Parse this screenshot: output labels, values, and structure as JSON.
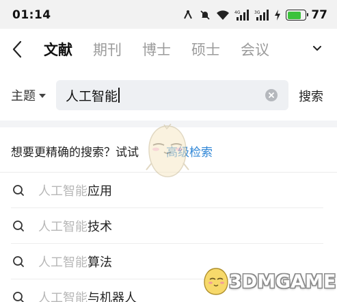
{
  "status_bar": {
    "time": "01:14",
    "battery_level": "77",
    "battery_percent": 0.77,
    "icons": [
      "nfc-icon",
      "mute-icon",
      "wifi-icon",
      "signal-4g-icon",
      "signal-3g-icon",
      "charging-icon",
      "battery-icon"
    ],
    "battery_color": "#3bc23b"
  },
  "header": {
    "back_icon": "chevron-left-icon",
    "tabs": [
      {
        "label": "文献",
        "active": true
      },
      {
        "label": "期刊",
        "active": false
      },
      {
        "label": "博士",
        "active": false
      },
      {
        "label": "硕士",
        "active": false
      },
      {
        "label": "会议",
        "active": false
      }
    ],
    "more_icon": "chevron-down-icon"
  },
  "search": {
    "scope_label": "主题",
    "query": "人工智能",
    "clear_icon": "clear-icon",
    "submit_label": "搜索"
  },
  "advanced_hint": {
    "prompt": "想要更精确的搜索？试试",
    "link_label": "高级检索",
    "link_color": "#2f86d6"
  },
  "suggestions": [
    {
      "prefix": "人工智能",
      "suffix": "应用"
    },
    {
      "prefix": "人工智能",
      "suffix": "技术"
    },
    {
      "prefix": "人工智能",
      "suffix": "算法"
    },
    {
      "prefix": "人工智能",
      "suffix": "与机器人"
    }
  ],
  "watermark": {
    "text": "3DMGAME"
  }
}
